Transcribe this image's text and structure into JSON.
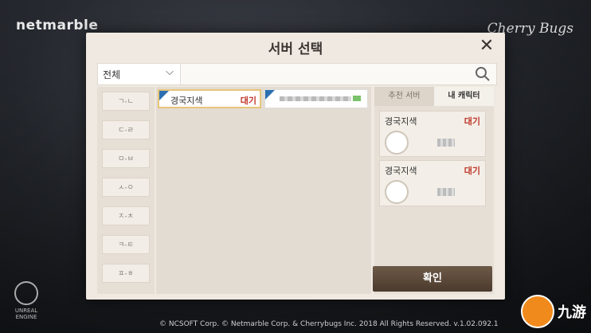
{
  "background": {
    "brand_left": "netmarble",
    "brand_right": "Cherry Bugs",
    "copyright": "© NCSOFT Corp. © Netmarble Corp. & Cherrybugs Inc. 2018 All Rights Reserved. v.1.02.092.1",
    "engine_label": "UNREAL ENGINE",
    "site_logo_text": "九游"
  },
  "dialog": {
    "title": "서버 선택",
    "close_icon": "close-icon",
    "filter": {
      "selected": "전체",
      "icon": "chevron-down-icon"
    },
    "search_icon": "search-icon",
    "index_buttons": [
      "ㄱ-ㄴ",
      "ㄷ-ㄹ",
      "ㅁ-ㅂ",
      "ㅅ-ㅇ",
      "ㅈ-ㅊ",
      "ㅋ-ㅌ",
      "ㅍ-ㅎ"
    ],
    "servers": [
      {
        "name": "경국지색",
        "status": "대기",
        "tag": "new"
      }
    ],
    "tabs": {
      "recommended": "추천 서버",
      "my_character": "내 캐릭터"
    },
    "characters": [
      {
        "server": "경국지색",
        "status": "대기",
        "avatar_icon": "character-avatar-icon"
      },
      {
        "server": "경국지색",
        "status": "대기",
        "avatar_icon": "character-avatar-icon"
      }
    ],
    "confirm_label": "확인",
    "accent_colors": {
      "status": "#c0392b",
      "selected_border": "#e7c57a",
      "tag": "#2c6fb0"
    }
  }
}
